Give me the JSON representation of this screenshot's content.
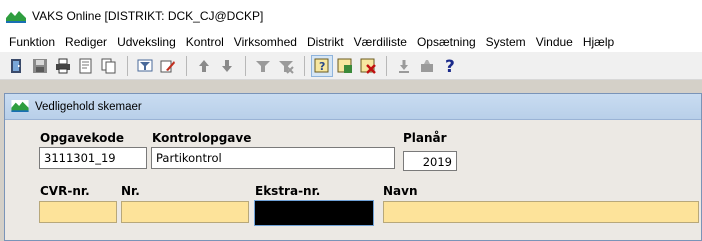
{
  "window": {
    "title": "VAKS Online [DISTRIKT: DCK_CJ@DCKP]"
  },
  "menu": [
    "Funktion",
    "Rediger",
    "Udveksling",
    "Kontrol",
    "Virksomhed",
    "Distrikt",
    "Værdiliste",
    "Opsætning",
    "System",
    "Vindue",
    "Hjælp"
  ],
  "toolbar": {
    "icons": [
      "exit-icon",
      "save-icon",
      "print-icon",
      "preview-icon",
      "copy-icon",
      "filter-icon",
      "edit-icon",
      "up-arrow-icon",
      "down-arrow-icon",
      "filter-form-icon",
      "filter-clear-icon",
      "query-icon",
      "query-run-icon",
      "query-cancel-icon",
      "download-icon",
      "delete-icon",
      "help-icon"
    ],
    "help_glyph": "?"
  },
  "child": {
    "title": "Vedligehold skemaer"
  },
  "form": {
    "opgavekode": {
      "label": "Opgavekode",
      "value": "3111301_19"
    },
    "kontrolopgave": {
      "label": "Kontrolopgave",
      "value": "Partikontrol"
    },
    "planaar": {
      "label": "Planår",
      "value": "2019"
    },
    "cvr": {
      "label": "CVR-nr.",
      "value": ""
    },
    "nr": {
      "label": "Nr.",
      "value": ""
    },
    "ekstra": {
      "label": "Ekstra-nr.",
      "value": ""
    },
    "navn": {
      "label": "Navn",
      "value": ""
    }
  },
  "colors": {
    "field_yellow": "#fde39a",
    "child_title": "#c9dcf1",
    "app_icon_green": "#2f9e3f"
  }
}
